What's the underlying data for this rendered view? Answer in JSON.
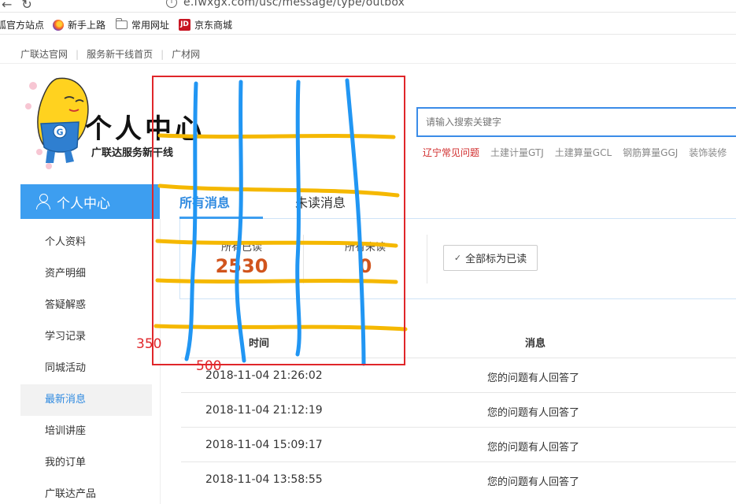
{
  "browser": {
    "url_visible": "e.fwxgx.com/usc/message/type/outbox",
    "info_symbol": "i",
    "bookmarks": [
      "狐官方站点",
      "新手上路",
      "常用网址",
      "京东商城"
    ],
    "jd_badge": "JD"
  },
  "site": {
    "top_links": [
      "广联达官网",
      "服务新干线首页",
      "广材网"
    ],
    "logo_title": "个人中心",
    "logo_subtitle": "广联达服务新干线",
    "mascot_letter": "G"
  },
  "search": {
    "placeholder": "请输入搜索关键字",
    "hot_words": [
      "辽宁常见问题",
      "土建计量GTJ",
      "土建算量GCL",
      "钢筋算量GGJ",
      "装饰装修"
    ]
  },
  "sidebar": {
    "header": "个人中心",
    "items": [
      "个人资料",
      "资产明细",
      "答疑解惑",
      "学习记录",
      "同城活动",
      "最新消息",
      "培训讲座",
      "我的订单",
      "广联达产品"
    ],
    "active_index": 5
  },
  "tabs": {
    "all": "所有消息",
    "unread": "未读消息"
  },
  "stats": {
    "read_label": "所有已读",
    "read_count": "2530",
    "unread_label": "所有未读",
    "unread_count": "0",
    "mark_all_button": "全部标为已读"
  },
  "table": {
    "headers": {
      "time": "时间",
      "message": "消息"
    },
    "rows": [
      {
        "time": "2018-11-04 21:26:02",
        "message": "您的问题有人回答了"
      },
      {
        "time": "2018-11-04 21:12:19",
        "message": "您的问题有人回答了"
      },
      {
        "time": "2018-11-04 15:09:17",
        "message": "您的问题有人回答了"
      },
      {
        "time": "2018-11-04 13:58:55",
        "message": "您的问题有人回答了"
      }
    ]
  },
  "annotation": {
    "label_350": "350",
    "label_500": "500",
    "box_color": "#e0262a",
    "horizontal_color": "#f5b800",
    "vertical_color": "#2196f3"
  },
  "colors": {
    "accent_blue": "#3d9ef0",
    "number_orange": "#d1541d",
    "hot_red": "#d12c2c"
  }
}
